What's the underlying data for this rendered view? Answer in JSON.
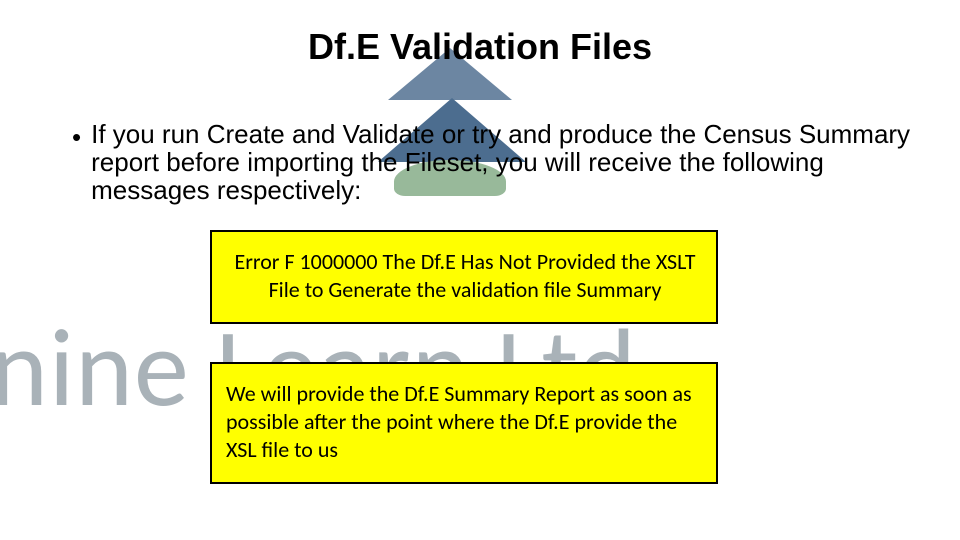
{
  "title": "Df.E Validation Files",
  "bullet": "If you run Create and Validate or try and produce the Census Summary report before importing the Fileset, you will receive the following messages respectively:",
  "message1": "Error F 1000000 The Df.E Has Not Provided the XSLT File to Generate the validation file Summary",
  "message2": "We will provide the Df.E Summary Report as soon as possible after the point where the Df.E provide the XSL file to us",
  "watermark_text": "Pennine Learn Ltd"
}
